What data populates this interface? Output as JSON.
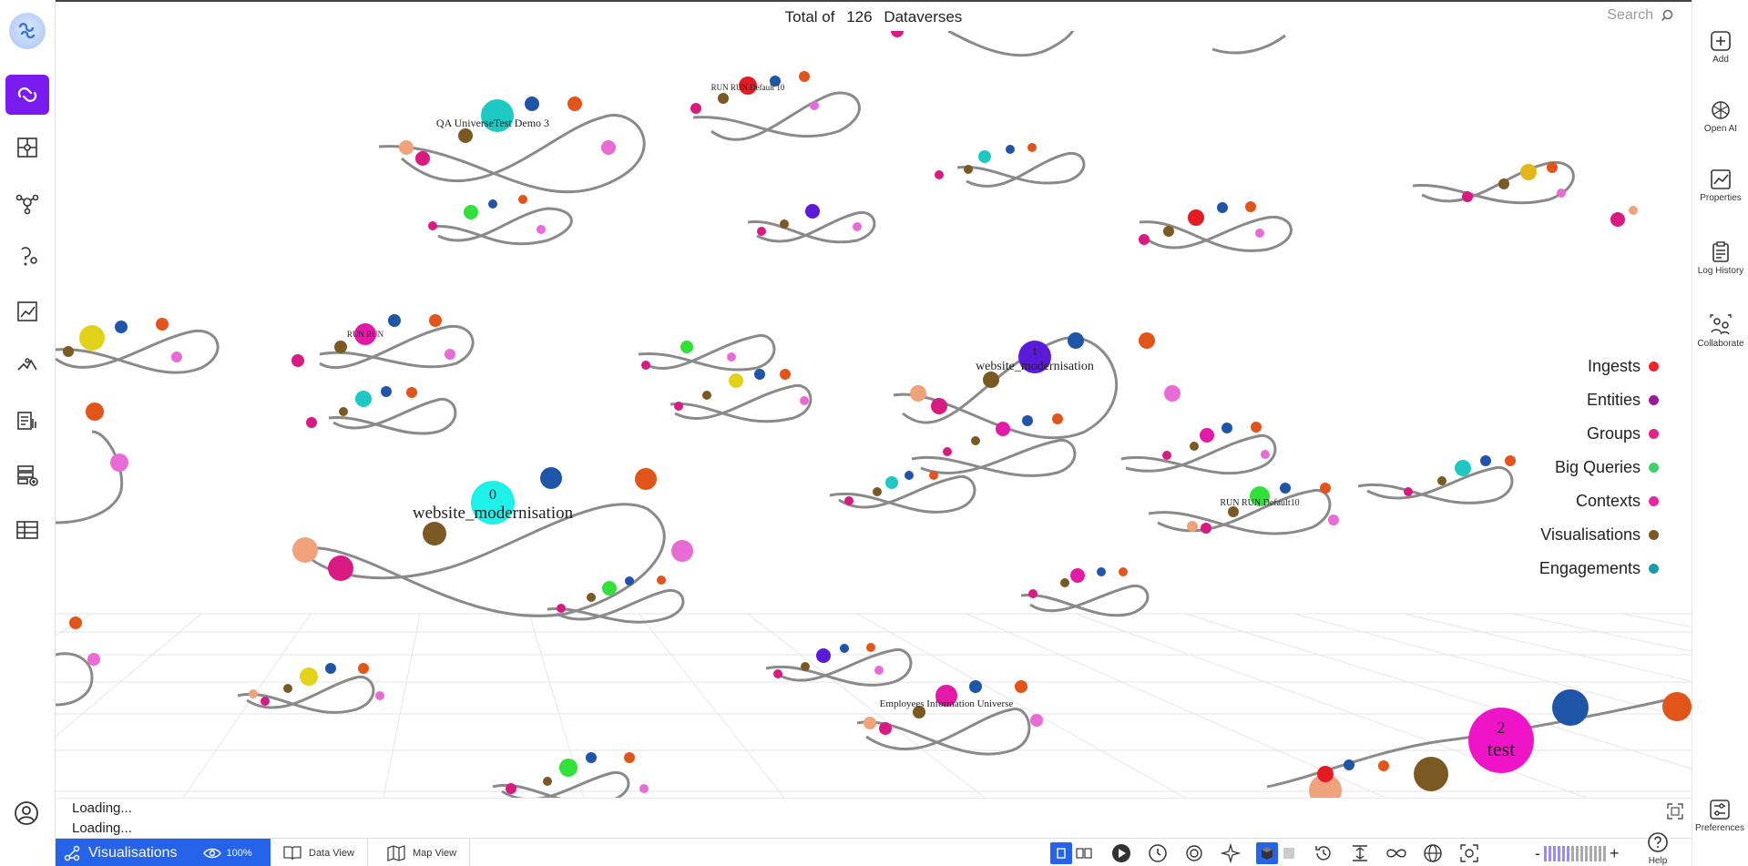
{
  "header": {
    "total_prefix": "Total of",
    "total_count": "126",
    "total_suffix": "Dataverses",
    "search_placeholder": "Search"
  },
  "right_bar": {
    "add": "Add",
    "open_ai": "Open AI",
    "properties": "Properties",
    "log_history": "Log History",
    "collaborate": "Collaborate",
    "preferences": "Preferences",
    "help": "Help"
  },
  "legend": [
    {
      "label": "Ingests",
      "color": "#e8252c"
    },
    {
      "label": "Entities",
      "color": "#9a1a9a"
    },
    {
      "label": "Groups",
      "color": "#e0248c"
    },
    {
      "label": "Big Queries",
      "color": "#3fd16b"
    },
    {
      "label": "Contexts",
      "color": "#e32aa0"
    },
    {
      "label": "Visualisations",
      "color": "#7a5a22"
    },
    {
      "label": "Engagements",
      "color": "#1c9aaa"
    }
  ],
  "canvas_labels": {
    "qa_universe": "QA UniverseTest Demo 3",
    "center_num": "1",
    "center_name": "website_modernisation",
    "big_num": "0",
    "big_name": "website_modernisation",
    "test_num": "2",
    "test_name": "test",
    "employees": "Employees Information Universe",
    "run_run": "RUN RUN",
    "run_default": "RUN RUN Default10",
    "run_test": "RUN RUN Default 10"
  },
  "console": {
    "line1": "Loading...",
    "line2": "Loading..."
  },
  "bottom_bar": {
    "vis_label": "Visualisations",
    "eye_value": "100%",
    "data_view": "Data View",
    "map_view": "Map View"
  },
  "colors": {
    "accent": "#7a1cf0",
    "tab_blue": "#2563eb"
  }
}
